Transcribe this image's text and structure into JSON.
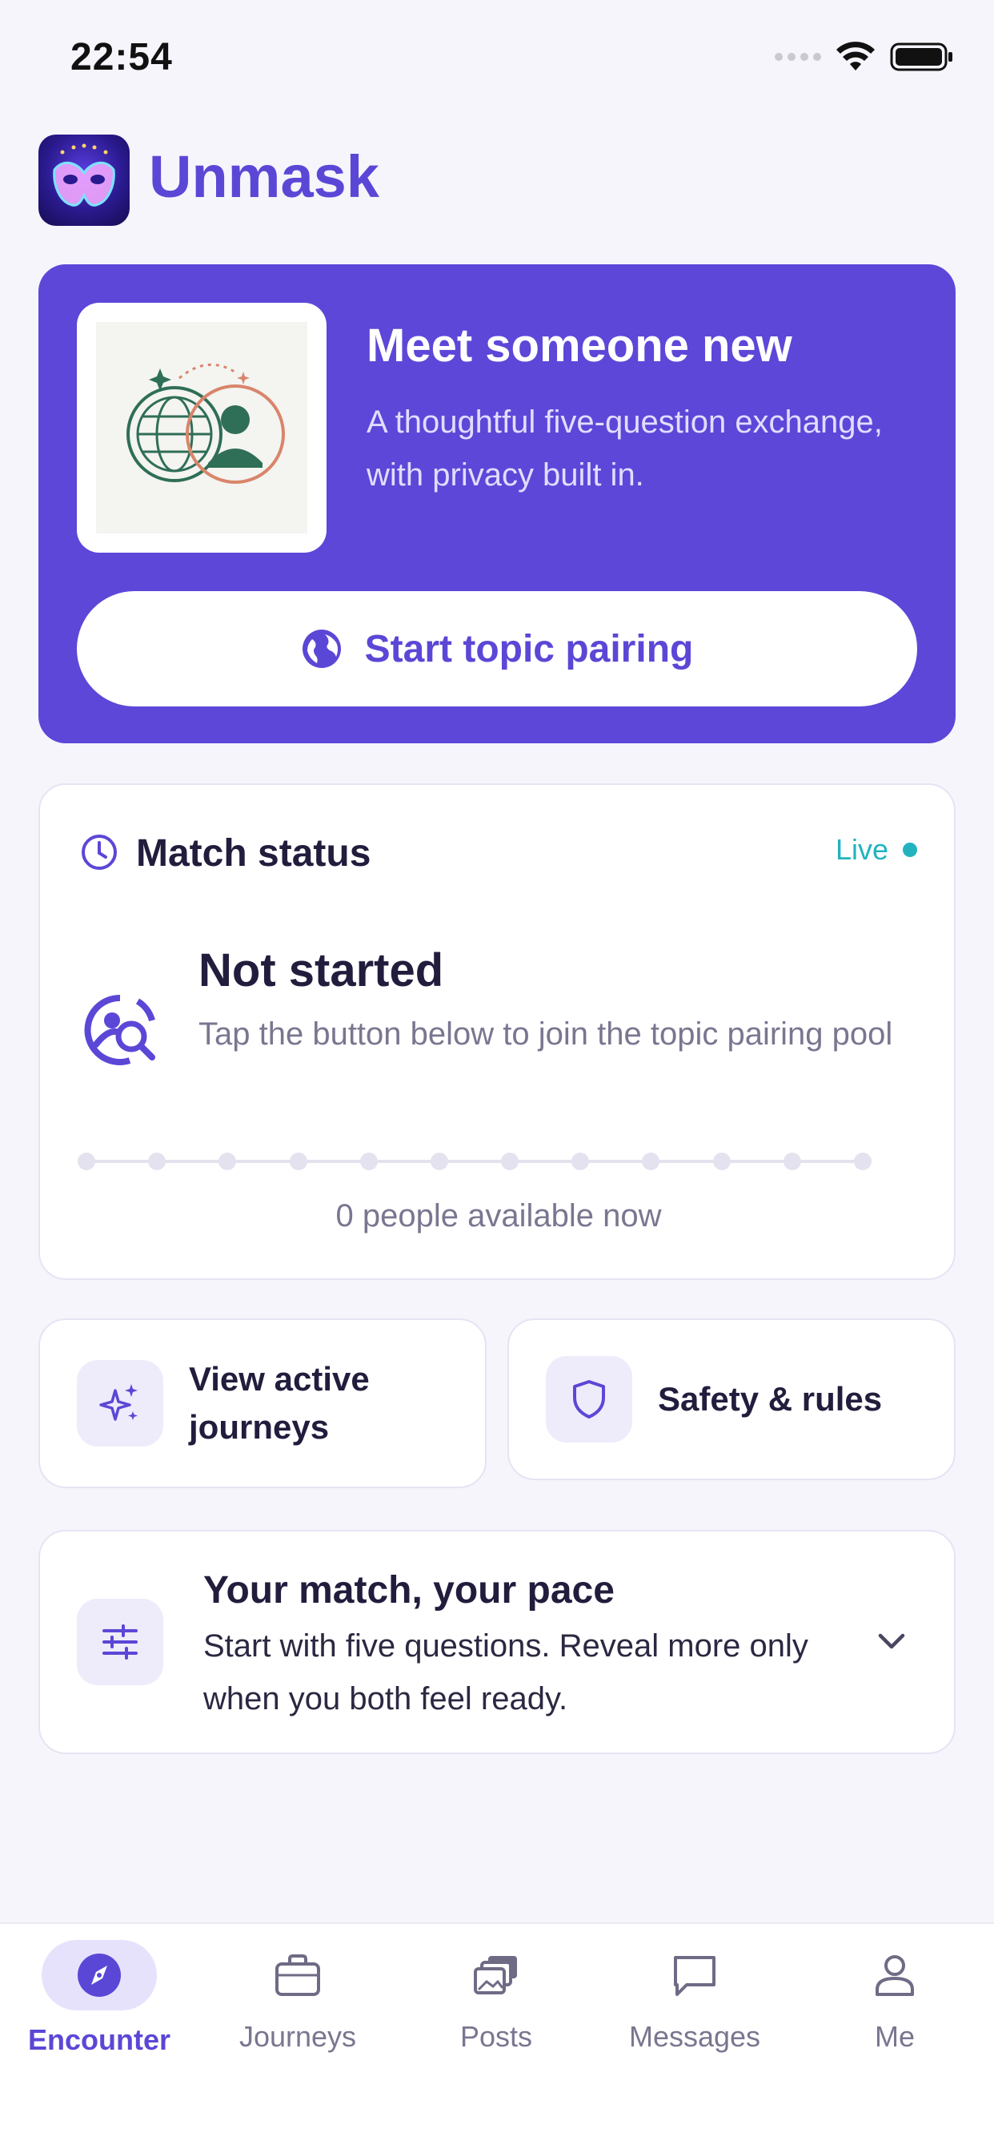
{
  "status_bar": {
    "time": "22:54"
  },
  "brand": {
    "name": "Unmask"
  },
  "hero": {
    "title": "Meet someone new",
    "subtitle": "A thoughtful five-question exchange, with privacy built in.",
    "cta_label": "Start topic pairing"
  },
  "match_status": {
    "title": "Match status",
    "live_label": "Live",
    "state_title": "Not started",
    "state_subtitle": "Tap the button below to join the topic pairing pool",
    "available_text": "0 people available now",
    "progress_dots": 12
  },
  "quick_actions": [
    {
      "label": "View active journeys",
      "icon": "sparkles-icon"
    },
    {
      "label": "Safety & rules",
      "icon": "shield-icon"
    }
  ],
  "pace_card": {
    "title": "Your match, your pace",
    "subtitle": "Start with five questions. Reveal more only when you both feel ready."
  },
  "tabs": [
    {
      "label": "Encounter",
      "icon": "compass-icon",
      "active": true
    },
    {
      "label": "Journeys",
      "icon": "briefcase-icon",
      "active": false
    },
    {
      "label": "Posts",
      "icon": "stacked-photos-icon",
      "active": false
    },
    {
      "label": "Messages",
      "icon": "chat-bubble-icon",
      "active": false
    },
    {
      "label": "Me",
      "icon": "person-icon",
      "active": false
    }
  ],
  "colors": {
    "accent": "#5b47d6",
    "hero_bg": "#5c47d8",
    "live": "#22b3bf",
    "background": "#f6f5fc"
  }
}
